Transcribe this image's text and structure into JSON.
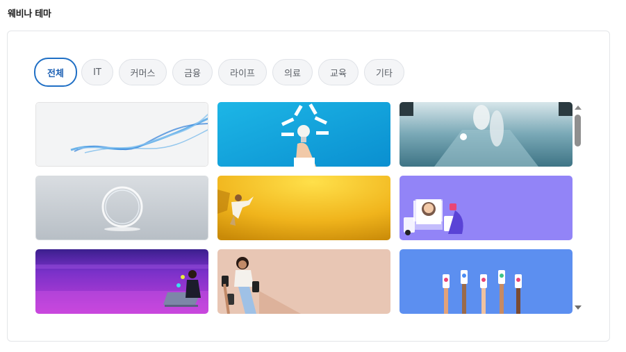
{
  "section": {
    "title": "웨비나 테마"
  },
  "filters": [
    {
      "label": "전체",
      "selected": true
    },
    {
      "label": "IT",
      "selected": false
    },
    {
      "label": "커머스",
      "selected": false
    },
    {
      "label": "금융",
      "selected": false
    },
    {
      "label": "라이프",
      "selected": false
    },
    {
      "label": "의료",
      "selected": false
    },
    {
      "label": "교육",
      "selected": false
    },
    {
      "label": "기타",
      "selected": false
    }
  ],
  "themes": [
    {
      "name": "blue-wave-theme"
    },
    {
      "name": "lightbulb-idea-theme"
    },
    {
      "name": "teal-runway-theme"
    },
    {
      "name": "glowing-ring-theme"
    },
    {
      "name": "yellow-jump-theme"
    },
    {
      "name": "purple-social-media-theme"
    },
    {
      "name": "purple-laptop-theme"
    },
    {
      "name": "peach-smartphone-theme"
    },
    {
      "name": "blue-raised-phones-theme"
    }
  ],
  "colors": {
    "accent": "#1f6fc5",
    "chip_bg": "#f4f5f7",
    "panel_border": "#e3e5e8"
  }
}
